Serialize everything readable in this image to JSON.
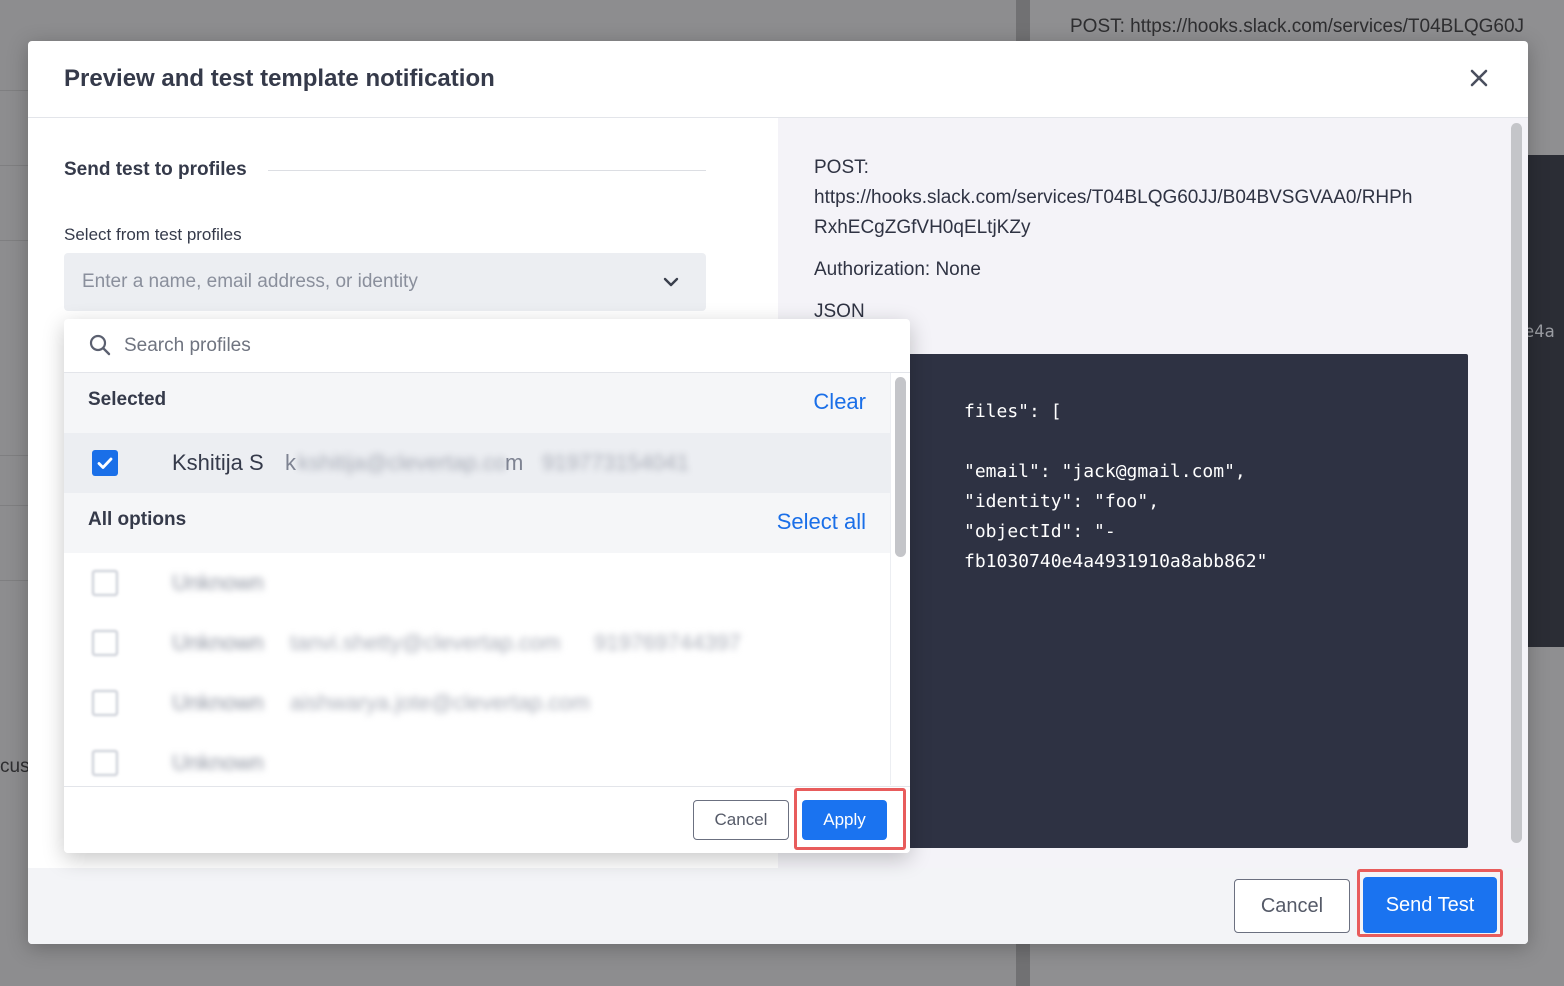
{
  "background": {
    "post_text": "POST: https://hooks.slack.com/services/T04BLQG60J",
    "code_fragment": "e4a",
    "left_fragment": "cust"
  },
  "modal": {
    "title": "Preview and test template notification",
    "close_icon": "close-icon",
    "left": {
      "section_title": "Send test to profiles",
      "field_label": "Select from test profiles",
      "select_placeholder": "Enter a name, email address, or identity"
    },
    "right": {
      "post_label": "POST:",
      "url_line1": "https://hooks.slack.com/services/T04BLQG60JJ/B04BVSGVAA0/RHPh",
      "url_line2": "RxhECgZGfVH0qELtjKZy",
      "authorization": "Authorization: None",
      "json_label": "JSON",
      "code_lines": [
        "files\": [",
        "",
        "\"email\": \"jack@gmail.com\",",
        "\"identity\": \"foo\",",
        "\"objectId\": \"-",
        "fb1030740e4a4931910a8abb862\""
      ]
    },
    "footer": {
      "cancel_label": "Cancel",
      "send_test_label": "Send Test"
    }
  },
  "dropdown": {
    "search_placeholder": "Search profiles",
    "selected_group": {
      "label": "Selected",
      "action": "Clear",
      "items": [
        {
          "name": "Kshitija S",
          "email_start": "k",
          "email_end": "m",
          "email_hidden": "kshitija@clevertap.co",
          "phone": "919773154041",
          "checked": true
        }
      ]
    },
    "all_group": {
      "label": "All options",
      "action": "Select all",
      "items": [
        {
          "name": "Unknown",
          "email": "",
          "phone": ""
        },
        {
          "name": "Unknown",
          "email": "tanvi.shetty@clevertap.com",
          "phone": "919769744397"
        },
        {
          "name": "Unknown",
          "email": "aishwarya.jote@clevertap.com",
          "phone": ""
        },
        {
          "name": "Unknown",
          "email": "",
          "phone": ""
        }
      ]
    },
    "footer": {
      "cancel_label": "Cancel",
      "apply_label": "Apply"
    }
  },
  "colors": {
    "primary": "#1a73f0",
    "highlight": "#e85c5c",
    "code_bg": "#2e3243"
  }
}
